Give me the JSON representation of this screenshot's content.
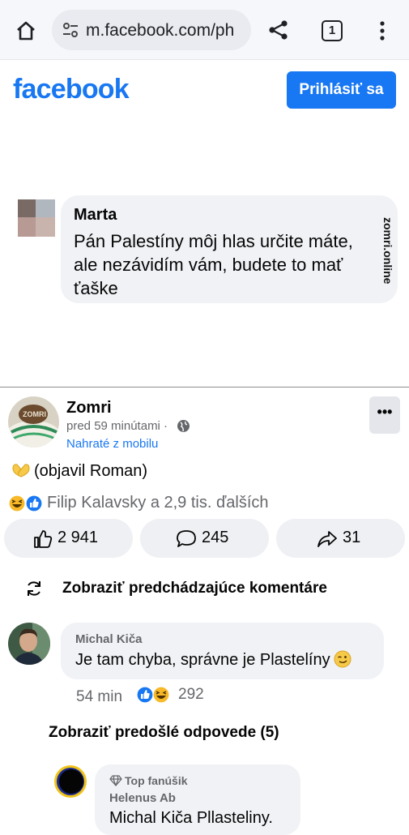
{
  "browser": {
    "url": "m.facebook.com/ph",
    "tab_count": "1"
  },
  "header": {
    "logo": "facebook",
    "login_label": "Prihlásiť sa"
  },
  "image": {
    "name": "Marta",
    "text": "Pán Palestíny môj hlas určite máte, ale nezávidím vám, budete to mať ťaške",
    "watermark": "zomri.online"
  },
  "post": {
    "author": "Zomri",
    "time": "pred 59 minútami ·",
    "source": "Nahraté z mobilu",
    "text": "(objavil Roman)",
    "reactions_text": "Filip Kalavsky a 2,9 tis. ďalších",
    "likes": "2 941",
    "comments": "245",
    "shares": "31"
  },
  "comments": {
    "show_previous": "Zobraziť predchádzajúce komentáre",
    "first": {
      "name": "Michal Kiča",
      "text": "Je tam chyba, správne je Plastelíny",
      "time": "54 min",
      "reaction_count": "292"
    },
    "show_replies": "Zobraziť predošlé odpovede (5)",
    "reply": {
      "badge": "Top fanúšik",
      "name": "Helenus Ab",
      "text": "Michal Kiča Pllasteliny."
    }
  },
  "colors": {
    "brand": "#1877f2",
    "muted": "#65676b",
    "bubble": "#f0f2f5"
  }
}
